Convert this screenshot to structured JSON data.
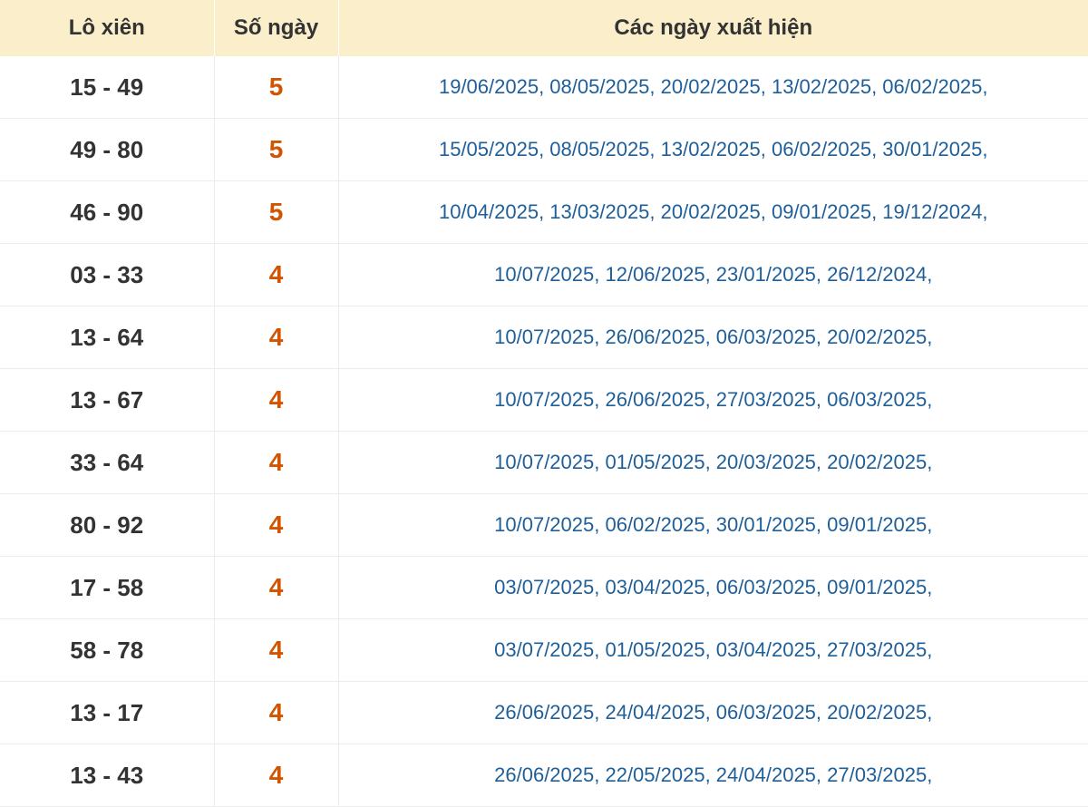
{
  "table": {
    "headers": [
      "Lô xiên",
      "Số ngày",
      "Các ngày xuất hiện"
    ],
    "rows": [
      {
        "pair": "15 - 49",
        "count": "5",
        "dates": "19/06/2025, 08/05/2025, 20/02/2025, 13/02/2025, 06/02/2025,"
      },
      {
        "pair": "49 - 80",
        "count": "5",
        "dates": "15/05/2025, 08/05/2025, 13/02/2025, 06/02/2025, 30/01/2025,"
      },
      {
        "pair": "46 - 90",
        "count": "5",
        "dates": "10/04/2025, 13/03/2025, 20/02/2025, 09/01/2025, 19/12/2024,"
      },
      {
        "pair": "03 - 33",
        "count": "4",
        "dates": "10/07/2025, 12/06/2025, 23/01/2025, 26/12/2024,"
      },
      {
        "pair": "13 - 64",
        "count": "4",
        "dates": "10/07/2025, 26/06/2025, 06/03/2025, 20/02/2025,"
      },
      {
        "pair": "13 - 67",
        "count": "4",
        "dates": "10/07/2025, 26/06/2025, 27/03/2025, 06/03/2025,"
      },
      {
        "pair": "33 - 64",
        "count": "4",
        "dates": "10/07/2025, 01/05/2025, 20/03/2025, 20/02/2025,"
      },
      {
        "pair": "80 - 92",
        "count": "4",
        "dates": "10/07/2025, 06/02/2025, 30/01/2025, 09/01/2025,"
      },
      {
        "pair": "17 - 58",
        "count": "4",
        "dates": "03/07/2025, 03/04/2025, 06/03/2025, 09/01/2025,"
      },
      {
        "pair": "58 - 78",
        "count": "4",
        "dates": "03/07/2025, 01/05/2025, 03/04/2025, 27/03/2025,"
      },
      {
        "pair": "13 - 17",
        "count": "4",
        "dates": "26/06/2025, 24/04/2025, 06/03/2025, 20/02/2025,"
      },
      {
        "pair": "13 - 43",
        "count": "4",
        "dates": "26/06/2025, 22/05/2025, 24/04/2025, 27/03/2025,"
      }
    ]
  },
  "colors": {
    "header_bg": "#fbeecb",
    "count_text": "#d35400",
    "date_text": "#1f5f99"
  }
}
